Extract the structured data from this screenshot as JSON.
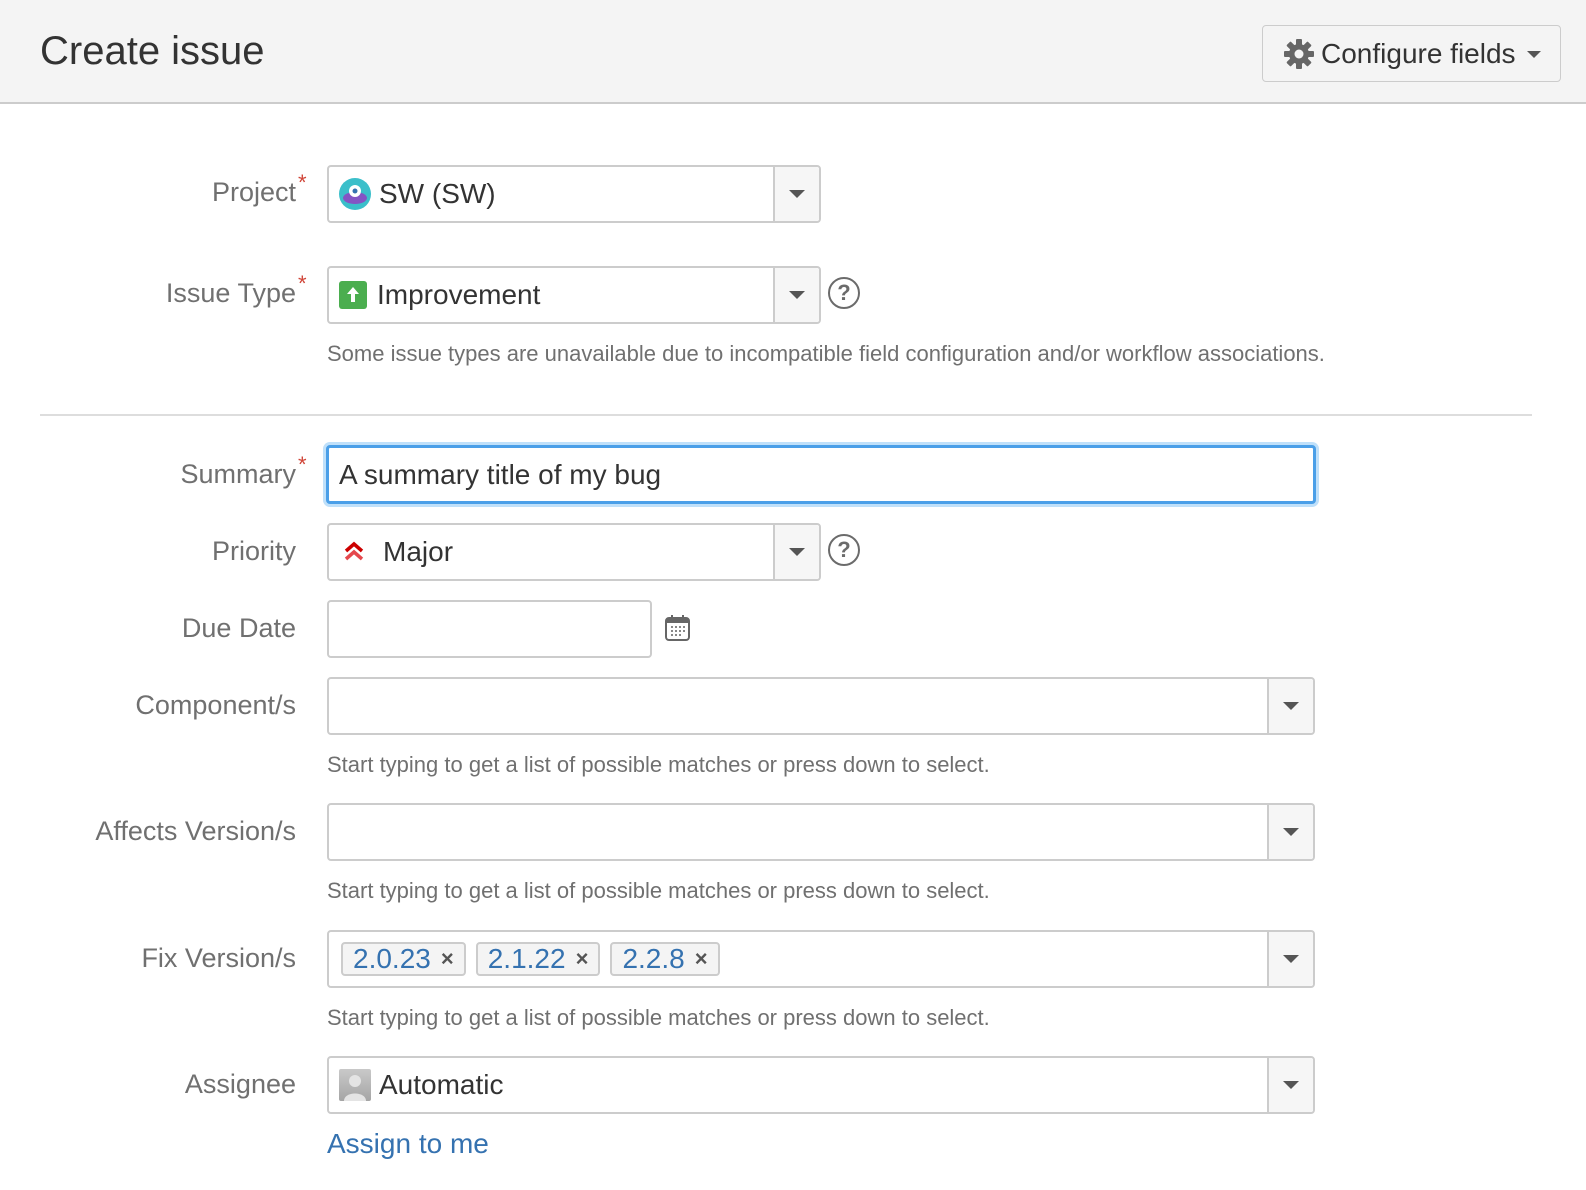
{
  "header": {
    "title": "Create issue",
    "configure_fields_label": "Configure fields"
  },
  "fields": {
    "project": {
      "label": "Project",
      "required": true,
      "value": "SW (SW)",
      "icon": "project-avatar-icon"
    },
    "issue_type": {
      "label": "Issue Type",
      "required": true,
      "value": "Improvement",
      "icon": "improvement-arrow-icon",
      "description": "Some issue types are unavailable due to incompatible field configuration and/or workflow associations."
    },
    "summary": {
      "label": "Summary",
      "required": true,
      "value": "A summary title of my bug"
    },
    "priority": {
      "label": "Priority",
      "required": false,
      "value": "Major",
      "icon": "priority-major-icon"
    },
    "due_date": {
      "label": "Due Date",
      "value": ""
    },
    "components": {
      "label": "Component/s",
      "value": "",
      "hint": "Start typing to get a list of possible matches or press down to select."
    },
    "affects_versions": {
      "label": "Affects Version/s",
      "value": "",
      "hint": "Start typing to get a list of possible matches or press down to select."
    },
    "fix_versions": {
      "label": "Fix Version/s",
      "tags": [
        "2.0.23",
        "2.1.22",
        "2.2.8"
      ],
      "remove_glyph": "×",
      "hint": "Start typing to get a list of possible matches or press down to select."
    },
    "assignee": {
      "label": "Assignee",
      "value": "Automatic",
      "assign_to_me_label": "Assign to me"
    }
  },
  "required_marker": "*",
  "help_glyph": "?",
  "colors": {
    "link": "#3572b0",
    "required": "#d04437",
    "focus_border": "#4a9fe8",
    "improvement_green": "#4bae4f",
    "priority_red": "#d04437"
  }
}
